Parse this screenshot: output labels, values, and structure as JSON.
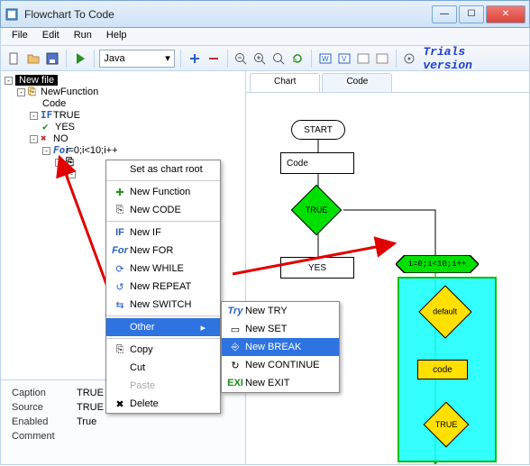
{
  "title": "Flowchart To Code",
  "menubar": [
    "File",
    "Edit",
    "Run",
    "Help"
  ],
  "toolbar": {
    "language": "Java",
    "trials": "Trials version"
  },
  "tree": {
    "root": "New file",
    "func": "NewFunction",
    "code": "Code",
    "cond": "TRUE",
    "yes": "YES",
    "no": "NO",
    "for": "i=0;i<10;i++"
  },
  "props": {
    "caption_lbl": "Caption",
    "caption_val": "TRUE",
    "source_lbl": "Source",
    "source_val": "TRUE",
    "enabled_lbl": "Enabled",
    "enabled_val": "True",
    "comment_lbl": "Comment"
  },
  "tabs": {
    "chart": "Chart",
    "code": "Code"
  },
  "flow": {
    "start": "START",
    "code": "Code",
    "cond": "TRUE",
    "yes": "YES",
    "for": "i=0;i<10;i++",
    "default": "default",
    "innercode": "code",
    "innercond": "TRUE"
  },
  "ctx1": {
    "setroot": "Set as chart root",
    "newfunc": "New Function",
    "newcode": "New CODE",
    "newif": "New IF",
    "newfor": "New FOR",
    "newwhile": "New WHILE",
    "newrepeat": "New REPEAT",
    "newswitch": "New SWITCH",
    "other": "Other",
    "copy": "Copy",
    "cut": "Cut",
    "paste": "Paste",
    "delete": "Delete"
  },
  "ctx2": {
    "newtry": "New TRY",
    "newset": "New SET",
    "newbreak": "New BREAK",
    "newcontinue": "New CONTINUE",
    "newexit": "New EXIT"
  }
}
